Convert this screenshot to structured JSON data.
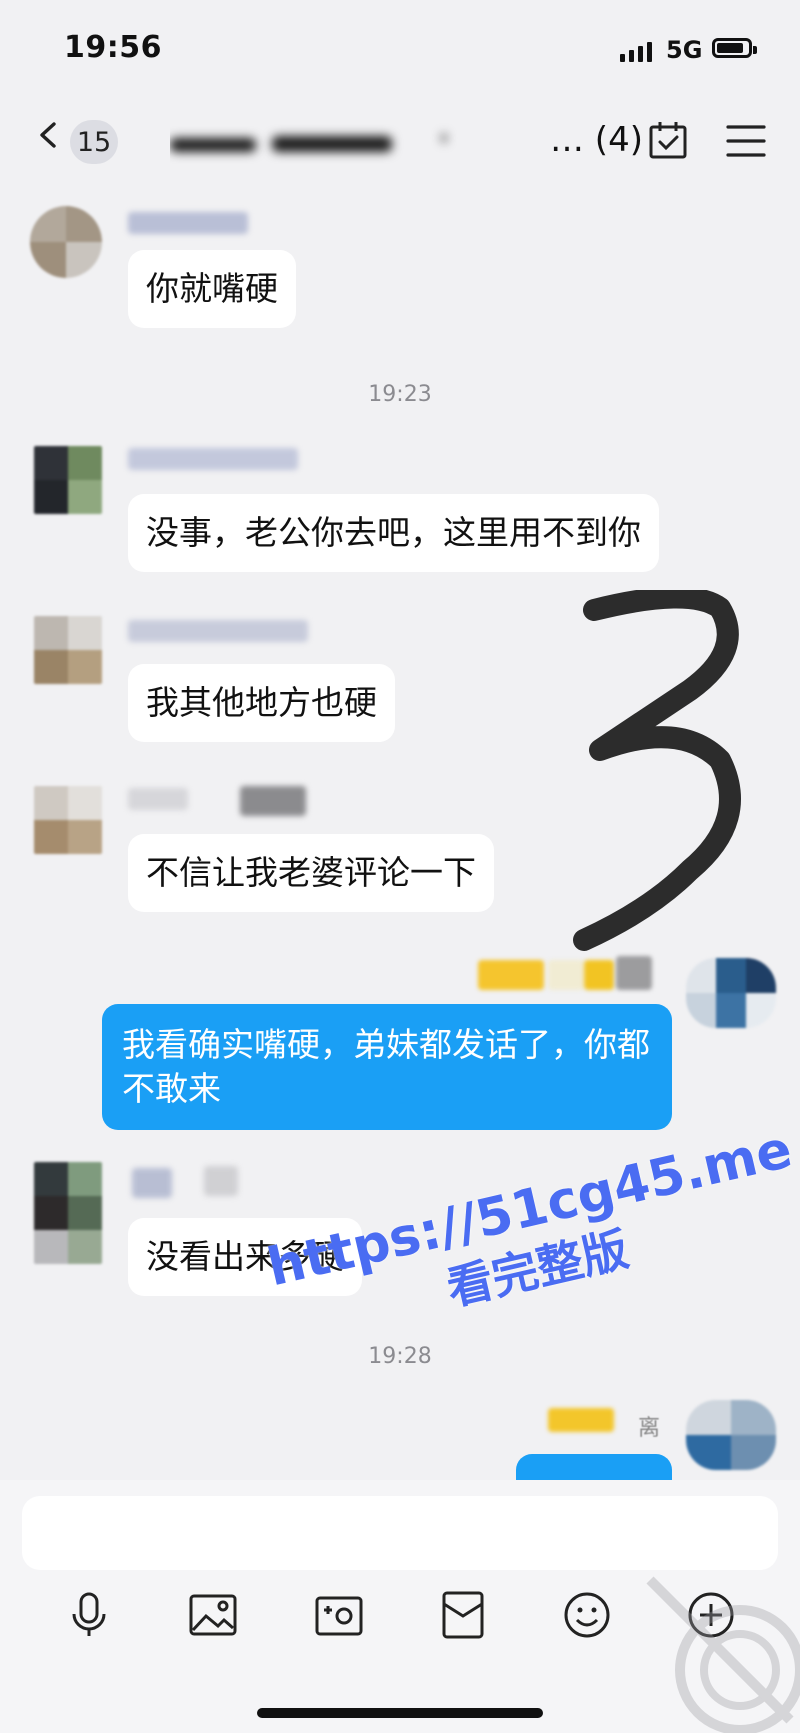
{
  "status_bar": {
    "time": "19:56",
    "network": "5G"
  },
  "header": {
    "unread_count": "15",
    "group_title": "",
    "member_count": "… (4)"
  },
  "messages": [
    {
      "text": "你就嘴硬"
    },
    {
      "text": "没事，老公你去吧，这里用不到你"
    },
    {
      "text": "我其他地方也硬"
    },
    {
      "text": "不信让我老婆评论一下"
    },
    {
      "text": "我看确实嘴硬，弟妹都发话了，你都不敢来"
    },
    {
      "text": "没看出来多硬"
    }
  ],
  "timestamps": [
    "19:23",
    "19:28"
  ],
  "partial_nick": "离",
  "toolbar_icons": [
    "microphone-icon",
    "image-icon",
    "camera-icon",
    "red-packet-icon",
    "emoji-icon",
    "plus-icon"
  ],
  "watermark": {
    "line1": "https://51cg45.me",
    "line2": "看完整版"
  },
  "colors": {
    "self_bubble": "#1a9ff5",
    "background": "#f1f1f3",
    "watermark": "#4a6cf2"
  }
}
